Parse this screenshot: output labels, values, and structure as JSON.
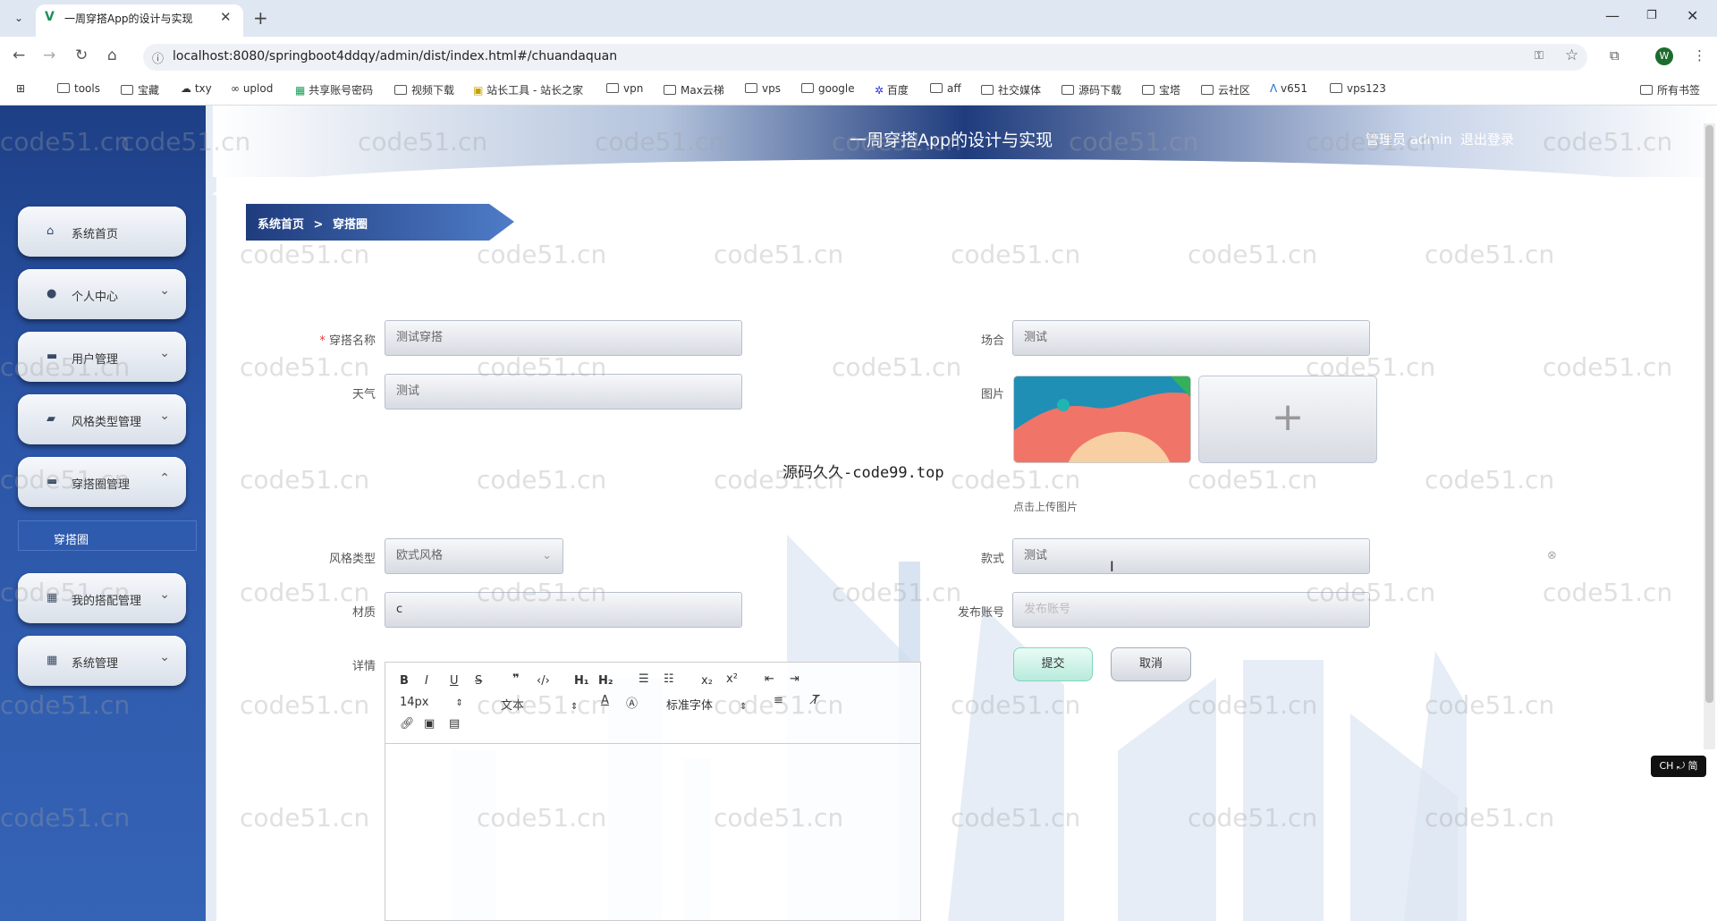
{
  "browser": {
    "tab_title": "一周穿搭App的设计与实现",
    "url": "localhost:8080/springboot4ddqy/admin/dist/index.html#/chuandaquan",
    "profile_initial": "W",
    "bookmarks": [
      "tools",
      "宝藏",
      "txy",
      "uplod",
      "共享账号密码",
      "视频下载",
      "站长工具 - 站长之家",
      "vpn",
      "Max云梯",
      "vps",
      "google",
      "百度",
      "aff",
      "社交媒体",
      "源码下载",
      "宝塔",
      "云社区",
      "v651",
      "vps123"
    ],
    "all_bookmarks": "所有书签"
  },
  "header": {
    "title": "一周穿搭App的设计与实现",
    "user_label": "管理员 admin",
    "logout": "退出登录"
  },
  "sidebar": {
    "items": [
      {
        "label": "系统首页",
        "icon": "home-icon"
      },
      {
        "label": "个人中心",
        "icon": "user-icon"
      },
      {
        "label": "用户管理",
        "icon": "users-icon"
      },
      {
        "label": "风格类型管理",
        "icon": "tag-icon"
      },
      {
        "label": "穿搭圈管理",
        "icon": "chat-icon"
      },
      {
        "label": "我的搭配管理",
        "icon": "grid-icon"
      },
      {
        "label": "系统管理",
        "icon": "grid-icon"
      }
    ],
    "submenu_label": "穿搭圈"
  },
  "breadcrumb": {
    "home": "系统首页",
    "separator": ">",
    "current": "穿搭圈"
  },
  "form": {
    "name": {
      "label": "穿搭名称",
      "value": "测试穿搭"
    },
    "occasion": {
      "label": "场合",
      "value": "测试"
    },
    "weather": {
      "label": "天气",
      "value": "测试"
    },
    "image": {
      "label": "图片",
      "hint": "点击上传图片"
    },
    "style_type": {
      "label": "风格类型",
      "value": "欧式风格"
    },
    "style": {
      "label": "款式",
      "value": "测试"
    },
    "material": {
      "label": "材质",
      "value": "c"
    },
    "account": {
      "label": "发布账号",
      "placeholder": "发布账号"
    },
    "details": {
      "label": "详情"
    },
    "submit": "提交",
    "cancel": "取消"
  },
  "editor": {
    "font_size": "14px",
    "block_type": "文本",
    "font_family": "标准字体"
  },
  "overlay_text": "源码久久-code99.top",
  "watermark": "code51.cn",
  "ime": "CH ⤾ 简",
  "colors": {
    "sidebar": "#2c56a8",
    "header_dark": "#1f3c7d",
    "submit": "#b8eadb"
  }
}
